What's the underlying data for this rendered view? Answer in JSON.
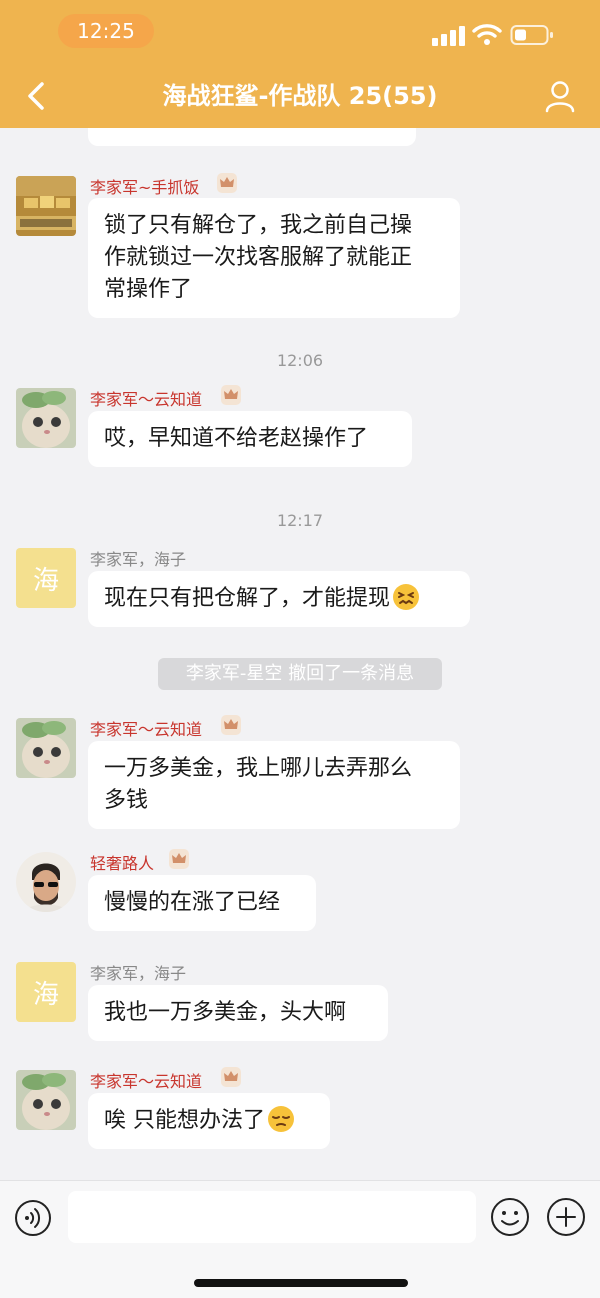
{
  "status_bar": {
    "time": "12:25"
  },
  "header": {
    "title": "海战狂鲨-作战队 25(55)"
  },
  "cut_message": {
    "text": ""
  },
  "messages": [
    {
      "sender": "李家军~手抓饭",
      "text_lines": [
        "锁了只有解仓了，我之前自己操",
        "作就锁过一次找客服解了就能正",
        "常操作了"
      ],
      "avatar_text": ""
    },
    {
      "sender": "李家军～云知道",
      "text": "哎，早知道不给老赵操作了"
    },
    {
      "sender": "李家军，海子",
      "text": "现在只有把仓解了，才能提现",
      "avatar_text": "海"
    },
    {
      "sender": "李家军～云知道",
      "text_lines": [
        "一万多美金，我上哪儿去弄那么",
        "多钱"
      ]
    },
    {
      "sender": "轻奢路人",
      "text": "慢慢的在涨了已经"
    },
    {
      "sender": "李家军，海子",
      "text": "我也一万多美金，头大啊",
      "avatar_text": "海"
    },
    {
      "sender": "李家军～云知道",
      "text": "唉 只能想办法了"
    }
  ],
  "timestamps": [
    "12:06",
    "12:17"
  ],
  "system": {
    "recall": "李家军-星空 撤回了一条消息"
  },
  "input": {
    "placeholder": ""
  },
  "icons": {
    "back": "chevron-left-icon",
    "profile": "person-icon",
    "crown": "crown-badge-icon",
    "voice": "voice-icon",
    "emoji": "smile-icon",
    "add": "plus-icon"
  },
  "colors": {
    "header": "#efb44f",
    "sender_red": "#c8352d",
    "sender_gray": "#888888",
    "bubble": "#ffffff",
    "background": "#f2f2f4"
  }
}
